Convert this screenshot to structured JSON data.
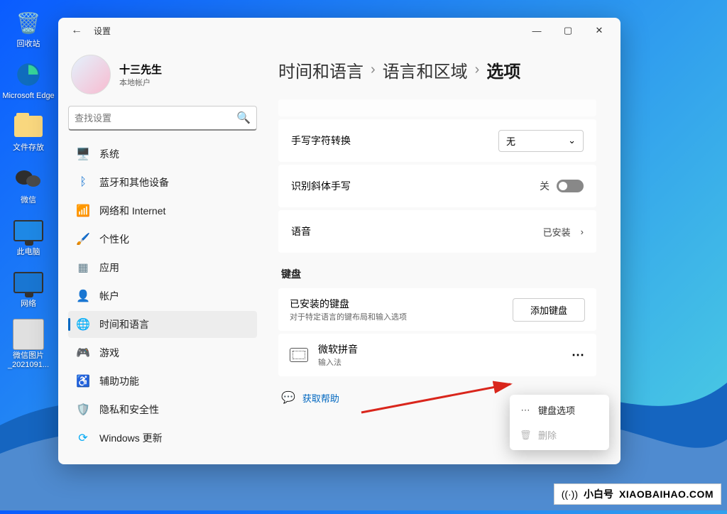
{
  "desktop": {
    "icons": [
      {
        "label": "回收站"
      },
      {
        "label": "Microsoft Edge"
      },
      {
        "label": "文件存放"
      },
      {
        "label": "微信"
      },
      {
        "label": "此电脑"
      },
      {
        "label": "网络"
      },
      {
        "label": "微信图片_2021091..."
      }
    ]
  },
  "window": {
    "title": "设置",
    "user": {
      "name": "十三先生",
      "sub": "本地帐户"
    },
    "search_placeholder": "查找设置",
    "nav": [
      {
        "label": "系统"
      },
      {
        "label": "蓝牙和其他设备"
      },
      {
        "label": "网络和 Internet"
      },
      {
        "label": "个性化"
      },
      {
        "label": "应用"
      },
      {
        "label": "帐户"
      },
      {
        "label": "时间和语言"
      },
      {
        "label": "游戏"
      },
      {
        "label": "辅助功能"
      },
      {
        "label": "隐私和安全性"
      },
      {
        "label": "Windows 更新"
      }
    ],
    "breadcrumb": {
      "a": "时间和语言",
      "b": "语言和区域",
      "c": "选项",
      "sep": "›"
    },
    "rows": {
      "handwriting": {
        "label": "手写字符转换",
        "value": "无"
      },
      "italic": {
        "label": "识别斜体手写",
        "state": "关"
      },
      "voice": {
        "label": "语音",
        "state": "已安装",
        "chev": "›"
      }
    },
    "kb": {
      "header": "键盘",
      "installed_title": "已安装的键盘",
      "installed_sub": "对于特定语言的键布局和输入选项",
      "add_btn": "添加键盘",
      "ms_pinyin": {
        "title": "微软拼音",
        "sub": "输入法"
      }
    },
    "help": "获取帮助",
    "context_menu": {
      "opt": "键盘选项",
      "del": "删除",
      "more": "⋯"
    }
  },
  "brand": {
    "cn": "小白号",
    "en": "XIAOBAIHAO.COM",
    "sig": "((·))"
  }
}
